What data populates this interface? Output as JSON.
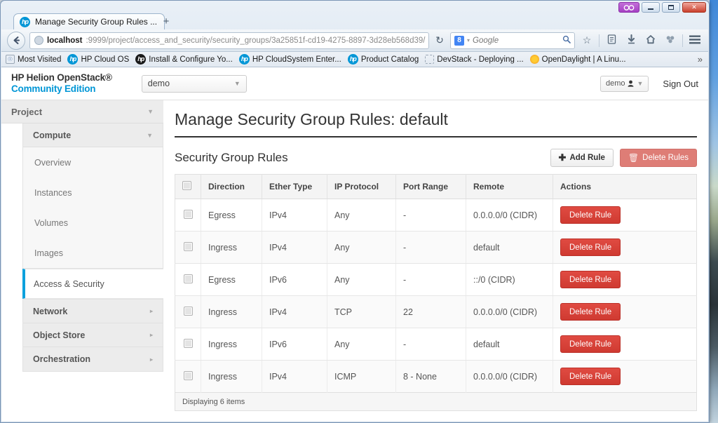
{
  "window": {
    "titlebar_buttons": [
      "∞",
      "minimize",
      "maximize",
      "✕"
    ],
    "purple_button_glyph": "∞"
  },
  "browser": {
    "tab": {
      "title": "Manage Security Group Rules ...",
      "favicon": "hp-logo-icon"
    },
    "new_tab_label": "+",
    "back_glyph": "←",
    "url": {
      "host": "localhost",
      "rest": ":9999/project/access_and_security/security_groups/3a25851f-cd19-4275-8897-3d28eb568d39/"
    },
    "url_dropdown_glyph": "▼",
    "reload_glyph": "↻",
    "search": {
      "engine_letter": "8",
      "caret": "▾",
      "placeholder": "Google",
      "magnifier": "⌕"
    },
    "toolbar_icons": [
      "☆",
      "☰",
      "⬇",
      "⌂",
      "❦",
      "☰"
    ],
    "bookmarks": [
      {
        "label": "Most Visited",
        "icon": "page-icon"
      },
      {
        "label": "HP Cloud OS",
        "icon": "hp-logo-icon"
      },
      {
        "label": "Install & Configure Yo...",
        "icon": "hp-logo-dark-icon"
      },
      {
        "label": "HP CloudSystem Enter...",
        "icon": "hp-logo-icon"
      },
      {
        "label": "Product Catalog",
        "icon": "hp-logo-icon"
      },
      {
        "label": "DevStack - Deploying ...",
        "icon": "dotted-icon"
      },
      {
        "label": "OpenDaylight | A Linu...",
        "icon": "sun-icon"
      }
    ],
    "bookmarks_overflow": "»"
  },
  "app": {
    "brand_line1": "HP Helion OpenStack®",
    "brand_line2": "Community Edition",
    "project_select": {
      "value": "demo",
      "caret": "▼"
    },
    "user_menu": {
      "label": "demo",
      "avatar": "user-icon",
      "caret": "▼"
    },
    "sign_out": "Sign Out",
    "accent_color": "#0096d6",
    "active_color": "#0ba1dd"
  },
  "sidebar": {
    "project_header": {
      "label": "Project",
      "caret": "▼"
    },
    "compute": {
      "label": "Compute",
      "caret": "▼"
    },
    "compute_items": [
      {
        "label": "Overview",
        "active": false
      },
      {
        "label": "Instances",
        "active": false
      },
      {
        "label": "Volumes",
        "active": false
      },
      {
        "label": "Images",
        "active": false
      },
      {
        "label": "Access & Security",
        "active": true
      }
    ],
    "groups": [
      {
        "label": "Network",
        "caret": "▸"
      },
      {
        "label": "Object Store",
        "caret": "▸"
      },
      {
        "label": "Orchestration",
        "caret": "▸"
      }
    ]
  },
  "main": {
    "page_title": "Manage Security Group Rules: default",
    "panel_title": "Security Group Rules",
    "add_rule_button": {
      "label": "Add Rule",
      "icon": "plus-icon"
    },
    "delete_rules_button": {
      "label": "Delete Rules",
      "icon": "trash-icon",
      "color": "#de7d76"
    },
    "table": {
      "headers": [
        "",
        "Direction",
        "Ether Type",
        "IP Protocol",
        "Port Range",
        "Remote",
        "Actions"
      ],
      "rows": [
        {
          "direction": "Egress",
          "ether_type": "IPv4",
          "ip_protocol": "Any",
          "port_range": "-",
          "remote": "0.0.0.0/0 (CIDR)",
          "action": "Delete Rule"
        },
        {
          "direction": "Ingress",
          "ether_type": "IPv4",
          "ip_protocol": "Any",
          "port_range": "-",
          "remote": "default",
          "action": "Delete Rule"
        },
        {
          "direction": "Egress",
          "ether_type": "IPv6",
          "ip_protocol": "Any",
          "port_range": "-",
          "remote": "::/0 (CIDR)",
          "action": "Delete Rule"
        },
        {
          "direction": "Ingress",
          "ether_type": "IPv4",
          "ip_protocol": "TCP",
          "port_range": "22",
          "remote": "0.0.0.0/0 (CIDR)",
          "action": "Delete Rule"
        },
        {
          "direction": "Ingress",
          "ether_type": "IPv6",
          "ip_protocol": "Any",
          "port_range": "-",
          "remote": "default",
          "action": "Delete Rule"
        },
        {
          "direction": "Ingress",
          "ether_type": "IPv4",
          "ip_protocol": "ICMP",
          "port_range": "8 - None",
          "remote": "0.0.0.0/0 (CIDR)",
          "action": "Delete Rule"
        }
      ]
    },
    "footer": "Displaying 6 items"
  }
}
